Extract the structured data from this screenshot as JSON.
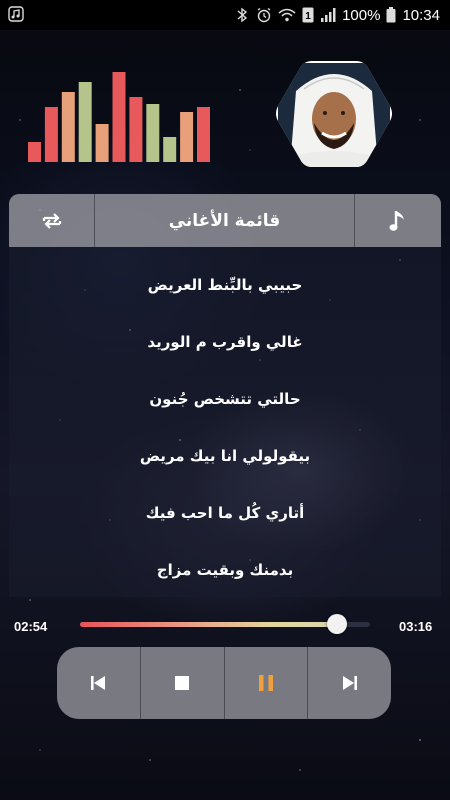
{
  "status_bar": {
    "battery_percent": "100%",
    "time": "10:34",
    "icons": [
      "music-app-icon",
      "bluetooth-icon",
      "alarm-icon",
      "wifi-calling-icon",
      "sim-1-icon",
      "signal-icon",
      "battery-icon"
    ]
  },
  "equalizer": {
    "colors": [
      "#e8595b",
      "#e8595b",
      "#e8a07a",
      "#b5c48a",
      "#e8a07a",
      "#e8595b",
      "#e8595b",
      "#b5c48a",
      "#b5c48a",
      "#e8a07a",
      "#e8595b"
    ],
    "levels": [
      0.2,
      0.55,
      0.7,
      0.8,
      0.38,
      0.9,
      0.65,
      0.58,
      0.25,
      0.5,
      0.55
    ]
  },
  "artist": {
    "image": "artist-photo"
  },
  "playlist": {
    "title": "قائمة الأغاني",
    "left_icon": "repeat-shuffle-icon",
    "right_icon": "music-note-icon",
    "songs": [
      "حبيبي بالبِّنط العريض",
      "غالي واقرب م الوريد",
      "حالتي تتشخص جُنون",
      "بيقولولي انا بيك مريض",
      "أتاري كُل ما احب فيك",
      "بدمنك وبقيت مزاج"
    ]
  },
  "player": {
    "current_time": "02:54",
    "duration": "03:16",
    "progress": 0.885,
    "controls": [
      "previous-icon",
      "stop-icon",
      "pause-icon",
      "next-icon"
    ],
    "accent": "#f0a03c"
  }
}
